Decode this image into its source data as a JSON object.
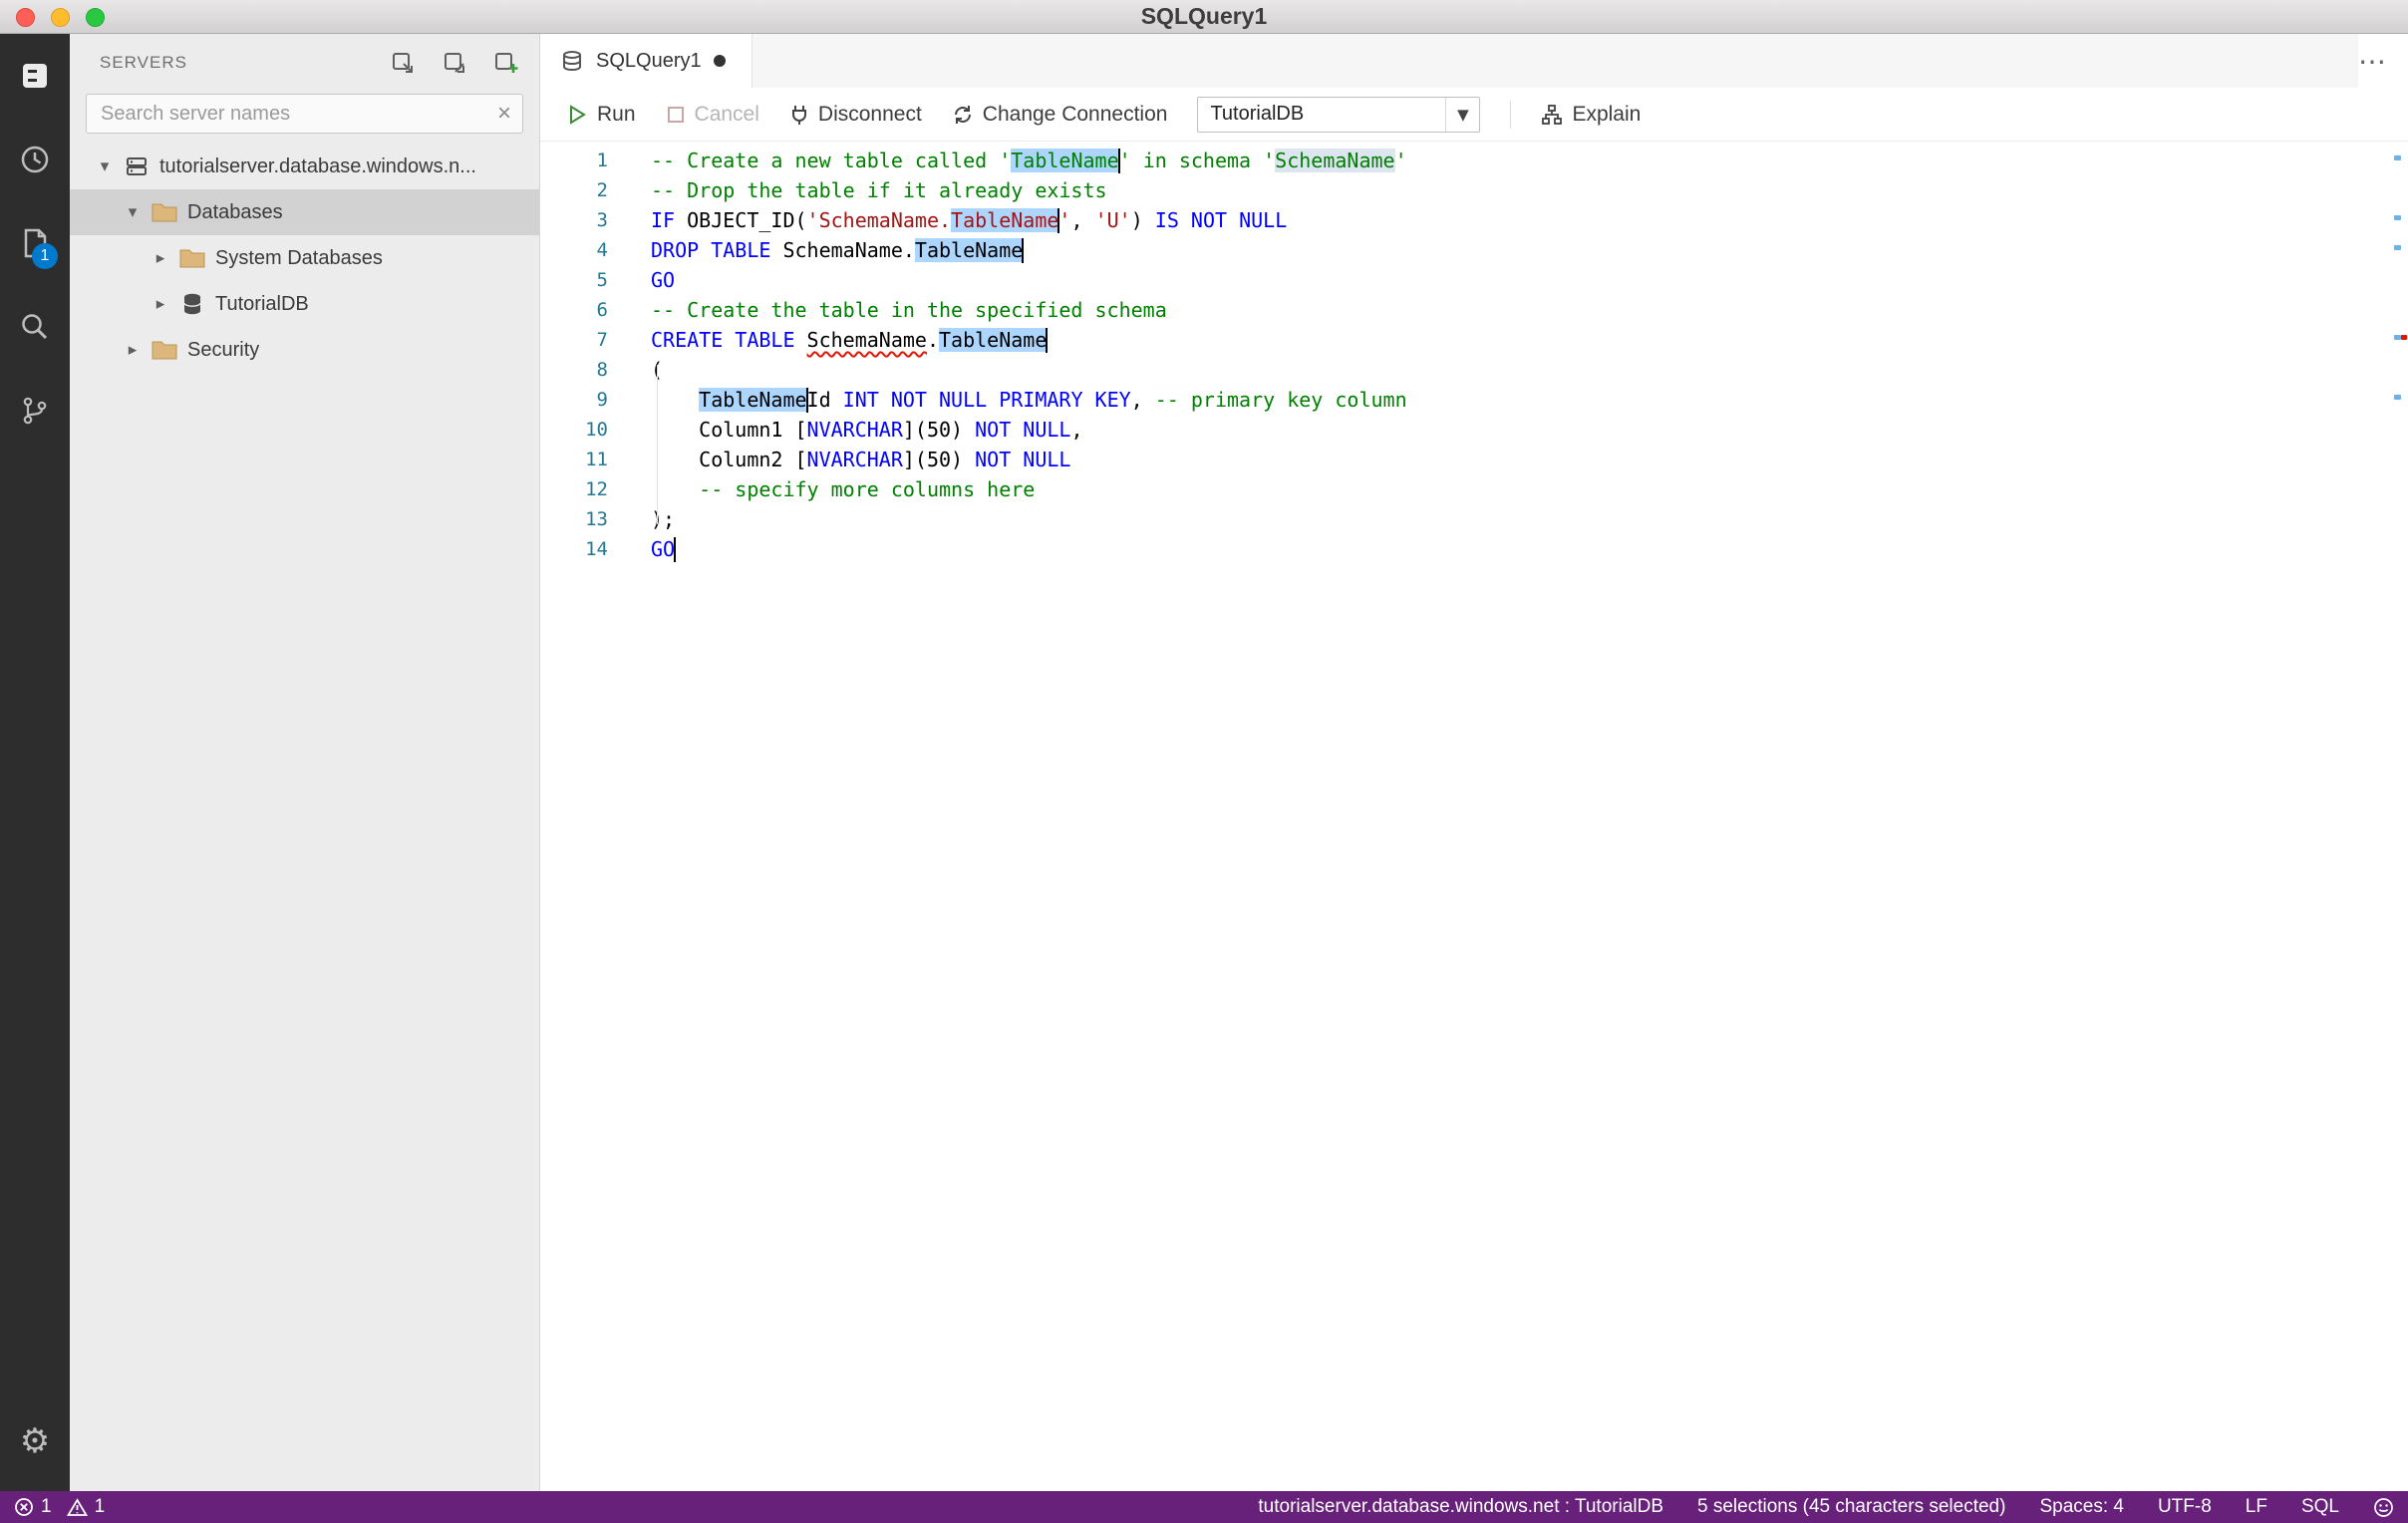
{
  "window": {
    "title": "SQLQuery1"
  },
  "activity_bar": {
    "badge_count": "1"
  },
  "sidebar": {
    "header": "SERVERS",
    "search": {
      "placeholder": "Search server names",
      "clear_glyph": "×"
    },
    "tree": [
      {
        "label": "tutorialserver.database.windows.n...",
        "indent": 0,
        "expanded": true,
        "icon": "server",
        "selected": false
      },
      {
        "label": "Databases",
        "indent": 1,
        "expanded": true,
        "icon": "folder",
        "selected": true
      },
      {
        "label": "System Databases",
        "indent": 2,
        "expanded": false,
        "icon": "folder",
        "selected": false
      },
      {
        "label": "TutorialDB",
        "indent": 2,
        "expanded": false,
        "icon": "database",
        "selected": false
      },
      {
        "label": "Security",
        "indent": 1,
        "expanded": false,
        "icon": "folder",
        "selected": false
      }
    ]
  },
  "editor": {
    "tab": {
      "label": "SQLQuery1",
      "modified": true
    },
    "more_actions_glyph": "⋯",
    "toolbar": {
      "run": "Run",
      "cancel": "Cancel",
      "disconnect": "Disconnect",
      "change_connection": "Change Connection",
      "database_dropdown": "TutorialDB",
      "caret_glyph": "▼",
      "explain": "Explain"
    },
    "code": {
      "lines": [
        {
          "n": "1",
          "tokens": [
            {
              "t": "-- Create a new table called '",
              "c": "c"
            },
            {
              "t": "TableName",
              "c": "c",
              "sel": true,
              "cur": true
            },
            {
              "t": "' in schema '",
              "c": "c"
            },
            {
              "t": "SchemaName",
              "c": "c",
              "occ": true
            },
            {
              "t": "'",
              "c": "c"
            }
          ]
        },
        {
          "n": "2",
          "tokens": [
            {
              "t": "-- Drop the table if it already exists",
              "c": "c"
            }
          ]
        },
        {
          "n": "3",
          "tokens": [
            {
              "t": "IF",
              "c": "k"
            },
            {
              "t": " OBJECT_ID(",
              "c": "p"
            },
            {
              "t": "'SchemaName.",
              "c": "s"
            },
            {
              "t": "TableName",
              "c": "s",
              "sel": true,
              "cur": true
            },
            {
              "t": "'",
              "c": "s"
            },
            {
              "t": ", ",
              "c": "p"
            },
            {
              "t": "'U'",
              "c": "s"
            },
            {
              "t": ") ",
              "c": "p"
            },
            {
              "t": "IS NOT NULL",
              "c": "k"
            }
          ]
        },
        {
          "n": "4",
          "tokens": [
            {
              "t": "DROP TABLE",
              "c": "k"
            },
            {
              "t": " SchemaName.",
              "c": "p"
            },
            {
              "t": "TableName",
              "c": "p",
              "sel": true,
              "cur": true
            }
          ]
        },
        {
          "n": "5",
          "tokens": [
            {
              "t": "GO",
              "c": "k"
            }
          ]
        },
        {
          "n": "6",
          "tokens": [
            {
              "t": "-- Create the table in the specified schema",
              "c": "c"
            }
          ]
        },
        {
          "n": "7",
          "tokens": [
            {
              "t": "CREATE TABLE",
              "c": "k"
            },
            {
              "t": " ",
              "c": "p"
            },
            {
              "t": "SchemaName",
              "c": "p",
              "sq": true
            },
            {
              "t": ".",
              "c": "p"
            },
            {
              "t": "TableName",
              "c": "p",
              "sel": true,
              "cur": true
            }
          ]
        },
        {
          "n": "8",
          "tokens": [
            {
              "t": "(",
              "c": "p"
            }
          ]
        },
        {
          "n": "9",
          "tokens": [
            {
              "t": "    ",
              "c": "p"
            },
            {
              "t": "TableName",
              "c": "p",
              "sel": true,
              "cur": true
            },
            {
              "t": "Id ",
              "c": "p"
            },
            {
              "t": "INT NOT NULL PRIMARY KEY",
              "c": "k"
            },
            {
              "t": ", ",
              "c": "p"
            },
            {
              "t": "-- primary key column",
              "c": "c"
            }
          ]
        },
        {
          "n": "10",
          "tokens": [
            {
              "t": "    Column1 [",
              "c": "p"
            },
            {
              "t": "NVARCHAR",
              "c": "k"
            },
            {
              "t": "](50) ",
              "c": "p"
            },
            {
              "t": "NOT NULL",
              "c": "k"
            },
            {
              "t": ",",
              "c": "p"
            }
          ]
        },
        {
          "n": "11",
          "tokens": [
            {
              "t": "    Column2 [",
              "c": "p"
            },
            {
              "t": "NVARCHAR",
              "c": "k"
            },
            {
              "t": "](50) ",
              "c": "p"
            },
            {
              "t": "NOT NULL",
              "c": "k"
            }
          ]
        },
        {
          "n": "12",
          "tokens": [
            {
              "t": "    ",
              "c": "p"
            },
            {
              "t": "-- specify more columns here",
              "c": "c"
            }
          ]
        },
        {
          "n": "13",
          "tokens": [
            {
              "t": ");",
              "c": "p"
            }
          ]
        },
        {
          "n": "14",
          "tokens": [
            {
              "t": "GO",
              "c": "k",
              "cur": true
            }
          ]
        }
      ]
    },
    "ruler": {
      "selection_lines": [
        1,
        3,
        4,
        7,
        9
      ],
      "error_lines": [
        7
      ]
    }
  },
  "status_bar": {
    "error_count": "1",
    "warning_count": "1",
    "connection": "tutorialserver.database.windows.net : TutorialDB",
    "selection": "5 selections (45 characters selected)",
    "spaces": "Spaces: 4",
    "encoding": "UTF-8",
    "eol": "LF",
    "language": "SQL"
  },
  "colors": {
    "accent": "#007acc",
    "statusbar": "#68217a",
    "selection_highlight": "#add6ff",
    "occurrence_highlight": "#dde6f0",
    "comment": "#008000",
    "keyword": "#0000ff",
    "string": "#a31515",
    "line_number": "#237893"
  }
}
